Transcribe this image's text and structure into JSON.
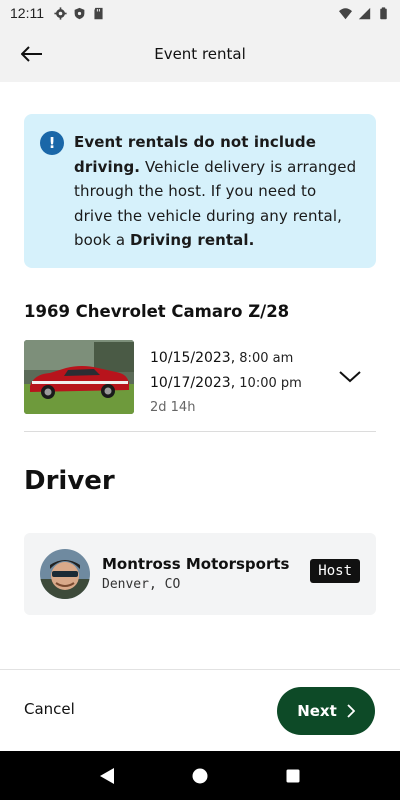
{
  "status_bar": {
    "time": "12:11",
    "left_icons": [
      "gear-icon",
      "shield-icon",
      "sd-card-icon"
    ],
    "right_icons": [
      "wifi-icon",
      "signal-icon",
      "battery-icon"
    ]
  },
  "app_bar": {
    "title": "Event rental",
    "back_icon": "arrow-left-icon"
  },
  "info_banner": {
    "icon": "exclamation-icon",
    "bold_lead": "Event rentals do not include driving.",
    "body": " Vehicle delivery is arranged through the host. If you need to drive the vehicle during any rental, book a ",
    "bold_tail": "Driving rental",
    "end": ".",
    "color": "#d6f1fb",
    "icon_color": "#1a67a8"
  },
  "vehicle": {
    "title": "1969 Chevrolet Camaro Z/28",
    "start_date": "10/15/2023,",
    "start_time": " 8:00 am",
    "end_date": "10/17/2023,",
    "end_time": " 10:00 pm",
    "duration": "2d 14h",
    "expand_icon": "chevron-down-icon"
  },
  "driver": {
    "heading": "Driver",
    "name": "Montross Motorsports",
    "location": "Denver, CO",
    "badge": "Host"
  },
  "footer": {
    "cancel_label": "Cancel",
    "next_label": "Next",
    "next_color": "#0d4a27"
  },
  "nav_bar": {
    "icons": [
      "back-triangle-icon",
      "home-circle-icon",
      "recents-square-icon"
    ]
  }
}
